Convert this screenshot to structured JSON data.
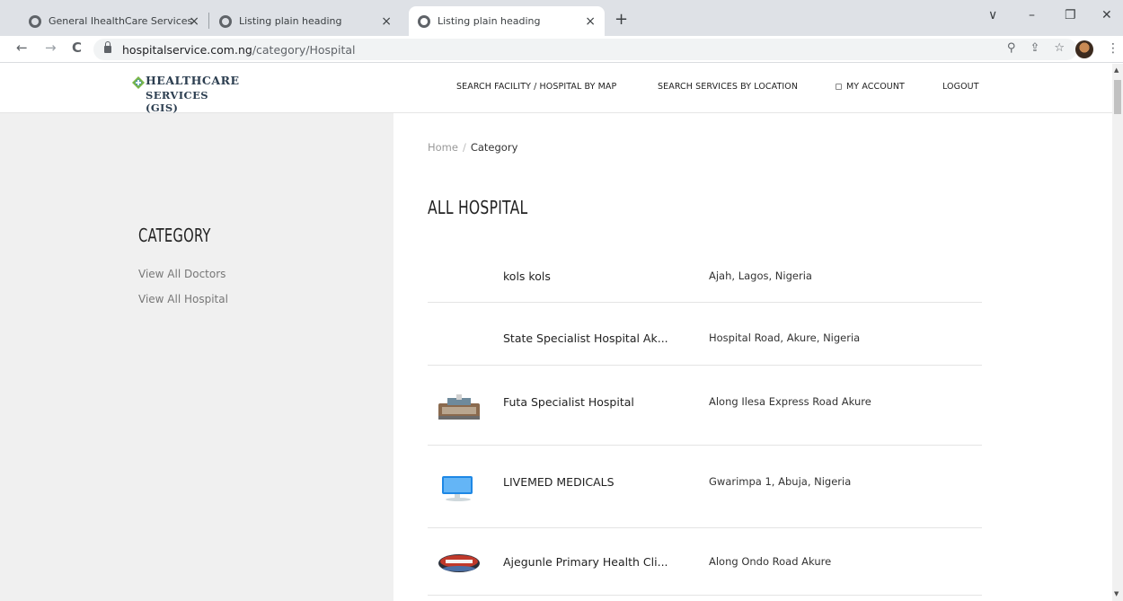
{
  "browser": {
    "tabs": [
      {
        "title": "General IhealthCare Services",
        "close": "×"
      },
      {
        "title": "Listing plain heading",
        "close": "×"
      },
      {
        "title": "Listing plain heading",
        "close": "×"
      }
    ],
    "new_tab": "+",
    "window_controls": {
      "menu": "∨",
      "minimize": "–",
      "restore": "❐",
      "close": "✕"
    },
    "nav": {
      "back": "←",
      "forward": "→",
      "reload": "C"
    },
    "url_host": "hospitalservice.com.ng",
    "url_path": "/category/Hospital",
    "omni_icons": {
      "zoom": "⚲",
      "share": "⇪",
      "bookmark": "☆"
    },
    "menu": "⋮"
  },
  "site": {
    "logo": {
      "line1": "HEALTHCARE",
      "line2": "SERVICES (GIS)"
    },
    "nav": {
      "map": "SEARCH FACILITY / HOSPITAL BY MAP",
      "location": "SEARCH SERVICES BY LOCATION",
      "account": "MY ACCOUNT",
      "logout": "LOGOUT"
    }
  },
  "sidebar": {
    "title": "CATEGORY",
    "links": [
      "View All Doctors",
      "View All Hospital"
    ]
  },
  "breadcrumb": {
    "home": "Home",
    "sep": "/",
    "current": "Category"
  },
  "main": {
    "title": "ALL HOSPITAL",
    "rows": [
      {
        "name": "kols kols",
        "location": "Ajah, Lagos, Nigeria",
        "thumb": "none"
      },
      {
        "name": "State Specialist Hospital Ak...",
        "location": "Hospital Road, Akure, Nigeria",
        "thumb": "none"
      },
      {
        "name": "Futa Specialist Hospital",
        "location": "Along Ilesa Express Road Akure",
        "thumb": "building-photo"
      },
      {
        "name": "LIVEMED MEDICALS",
        "location": "Gwarimpa 1, Abuja, Nigeria",
        "thumb": "computer-photo"
      },
      {
        "name": "Ajegunle Primary Health Cli...",
        "location": "Along Ondo Road Akure",
        "thumb": "hospital-sign-photo"
      }
    ]
  }
}
